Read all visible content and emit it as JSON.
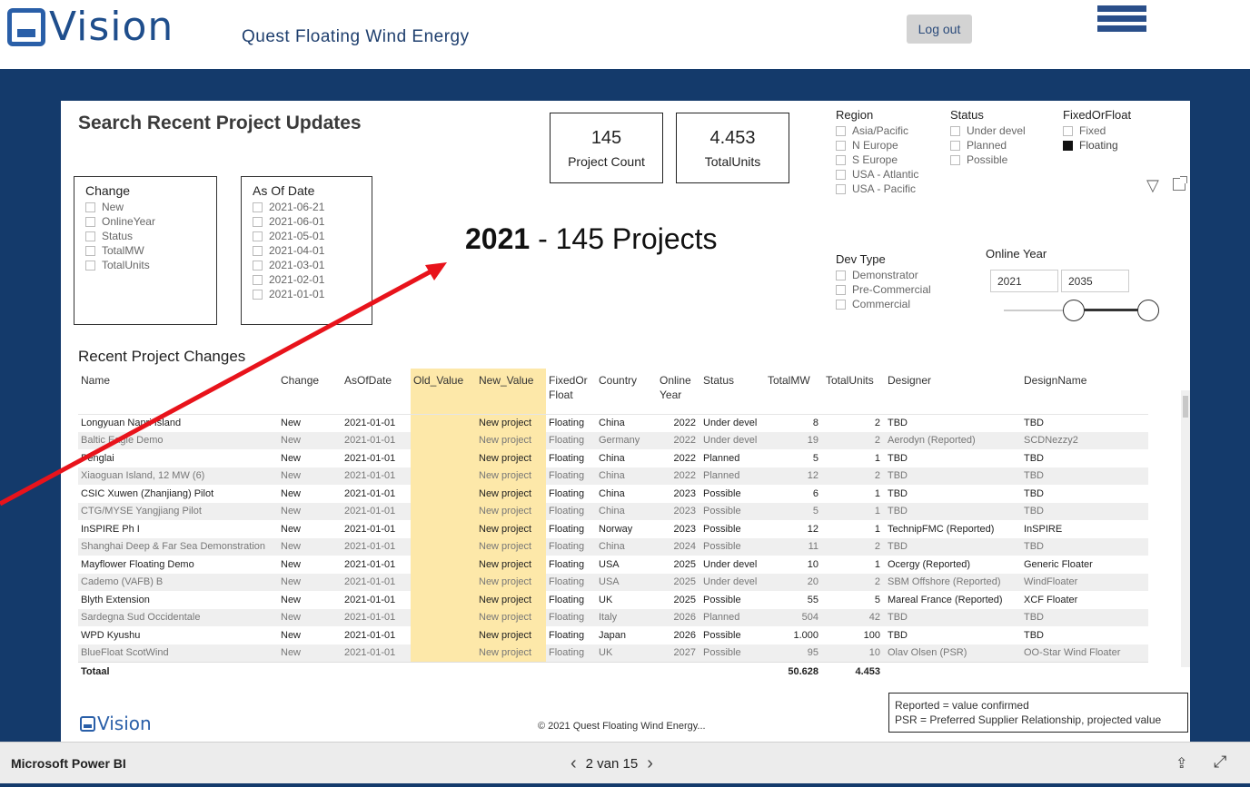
{
  "header": {
    "logo_text": "Vision",
    "subtitle": "Quest  Floating Wind Energy",
    "logout_label": "Log out"
  },
  "report": {
    "title": "Search Recent Project Updates",
    "kpis": [
      {
        "value": "145",
        "label": "Project Count"
      },
      {
        "value": "4.453",
        "label": "TotalUnits"
      }
    ],
    "headline_year": "2021",
    "headline_rest": " - 145 Projects",
    "change_slicer": {
      "header": "Change",
      "options": [
        "New",
        "OnlineYear",
        "Status",
        "TotalMW",
        "TotalUnits"
      ]
    },
    "asof_slicer": {
      "header": "As Of Date",
      "options": [
        "2021-06-21",
        "2021-06-01",
        "2021-05-01",
        "2021-04-01",
        "2021-03-01",
        "2021-02-01",
        "2021-01-01"
      ]
    },
    "region": {
      "header": "Region",
      "options": [
        "Asia/Pacific",
        "N Europe",
        "S Europe",
        "USA - Atlantic",
        "USA - Pacific"
      ]
    },
    "status": {
      "header": "Status",
      "options": [
        "Under devel",
        "Planned",
        "Possible"
      ]
    },
    "fixedorfloat": {
      "header": "FixedOrFloat",
      "options": [
        {
          "label": "Fixed",
          "checked": false
        },
        {
          "label": "Floating",
          "checked": true
        }
      ]
    },
    "devtype": {
      "header": "Dev Type",
      "options": [
        "Demonstrator",
        "Pre-Commercial",
        "Commercial"
      ]
    },
    "online_year": {
      "header": "Online Year",
      "from": "2021",
      "to": "2035"
    },
    "table_title": "Recent Project Changes",
    "columns": [
      "Name",
      "Change",
      "AsOfDate",
      "Old_Value",
      "New_Value",
      "FixedOr Float",
      "Country",
      "Online Year",
      "Status",
      "TotalMW",
      "TotalUnits",
      "Designer",
      "DesignName"
    ],
    "rows": [
      [
        "Longyuan Nanri Island",
        "New",
        "2021-01-01",
        "",
        "New project",
        "Floating",
        "China",
        "2022",
        "Under devel",
        "8",
        "2",
        "TBD",
        "TBD"
      ],
      [
        "Baltic Eagle Demo",
        "New",
        "2021-01-01",
        "",
        "New project",
        "Floating",
        "Germany",
        "2022",
        "Under devel",
        "19",
        "2",
        "Aerodyn (Reported)",
        "SCDNezzy2"
      ],
      [
        "Penglai",
        "New",
        "2021-01-01",
        "",
        "New project",
        "Floating",
        "China",
        "2022",
        "Planned",
        "5",
        "1",
        "TBD",
        "TBD"
      ],
      [
        "Xiaoguan Island, 12 MW (6)",
        "New",
        "2021-01-01",
        "",
        "New project",
        "Floating",
        "China",
        "2022",
        "Planned",
        "12",
        "2",
        "TBD",
        "TBD"
      ],
      [
        "CSIC Xuwen (Zhanjiang) Pilot",
        "New",
        "2021-01-01",
        "",
        "New project",
        "Floating",
        "China",
        "2023",
        "Possible",
        "6",
        "1",
        "TBD",
        "TBD"
      ],
      [
        "CTG/MYSE Yangjiang Pilot",
        "New",
        "2021-01-01",
        "",
        "New project",
        "Floating",
        "China",
        "2023",
        "Possible",
        "5",
        "1",
        "TBD",
        "TBD"
      ],
      [
        "InSPIRE Ph I",
        "New",
        "2021-01-01",
        "",
        "New project",
        "Floating",
        "Norway",
        "2023",
        "Possible",
        "12",
        "1",
        "TechnipFMC (Reported)",
        "InSPIRE"
      ],
      [
        "Shanghai Deep & Far Sea Demonstration",
        "New",
        "2021-01-01",
        "",
        "New project",
        "Floating",
        "China",
        "2024",
        "Possible",
        "11",
        "2",
        "TBD",
        "TBD"
      ],
      [
        "Mayflower Floating Demo",
        "New",
        "2021-01-01",
        "",
        "New project",
        "Floating",
        "USA",
        "2025",
        "Under devel",
        "10",
        "1",
        "Ocergy (Reported)",
        "Generic Floater"
      ],
      [
        "Cademo (VAFB) B",
        "New",
        "2021-01-01",
        "",
        "New project",
        "Floating",
        "USA",
        "2025",
        "Under devel",
        "20",
        "2",
        "SBM Offshore (Reported)",
        "WindFloater"
      ],
      [
        "Blyth Extension",
        "New",
        "2021-01-01",
        "",
        "New project",
        "Floating",
        "UK",
        "2025",
        "Possible",
        "55",
        "5",
        "Mareal France (Reported)",
        "XCF Floater"
      ],
      [
        "Sardegna Sud Occidentale",
        "New",
        "2021-01-01",
        "",
        "New project",
        "Floating",
        "Italy",
        "2026",
        "Planned",
        "504",
        "42",
        "TBD",
        "TBD"
      ],
      [
        "WPD Kyushu",
        "New",
        "2021-01-01",
        "",
        "New project",
        "Floating",
        "Japan",
        "2026",
        "Possible",
        "1.000",
        "100",
        "TBD",
        "TBD"
      ],
      [
        "BlueFloat ScotWind",
        "New",
        "2021-01-01",
        "",
        "New project",
        "Floating",
        "UK",
        "2027",
        "Possible",
        "95",
        "10",
        "Olav Olsen (PSR)",
        "OO-Star Wind Floater"
      ]
    ],
    "total_label": "Totaal",
    "total_mw": "50.628",
    "total_units": "4.453",
    "footer_logo": "Vision",
    "copyright": "© 2021 Quest Floating Wind Energy...",
    "note_lines": [
      "Reported = value confirmed",
      "PSR = Preferred Supplier Relationship, projected value"
    ]
  },
  "pbi": {
    "app_name": "Microsoft Power BI",
    "page_indicator": "2 van 15"
  },
  "colors": {
    "navy": "#143a6b",
    "highlight": "#fde8a9",
    "arrow": "#e8131b"
  }
}
